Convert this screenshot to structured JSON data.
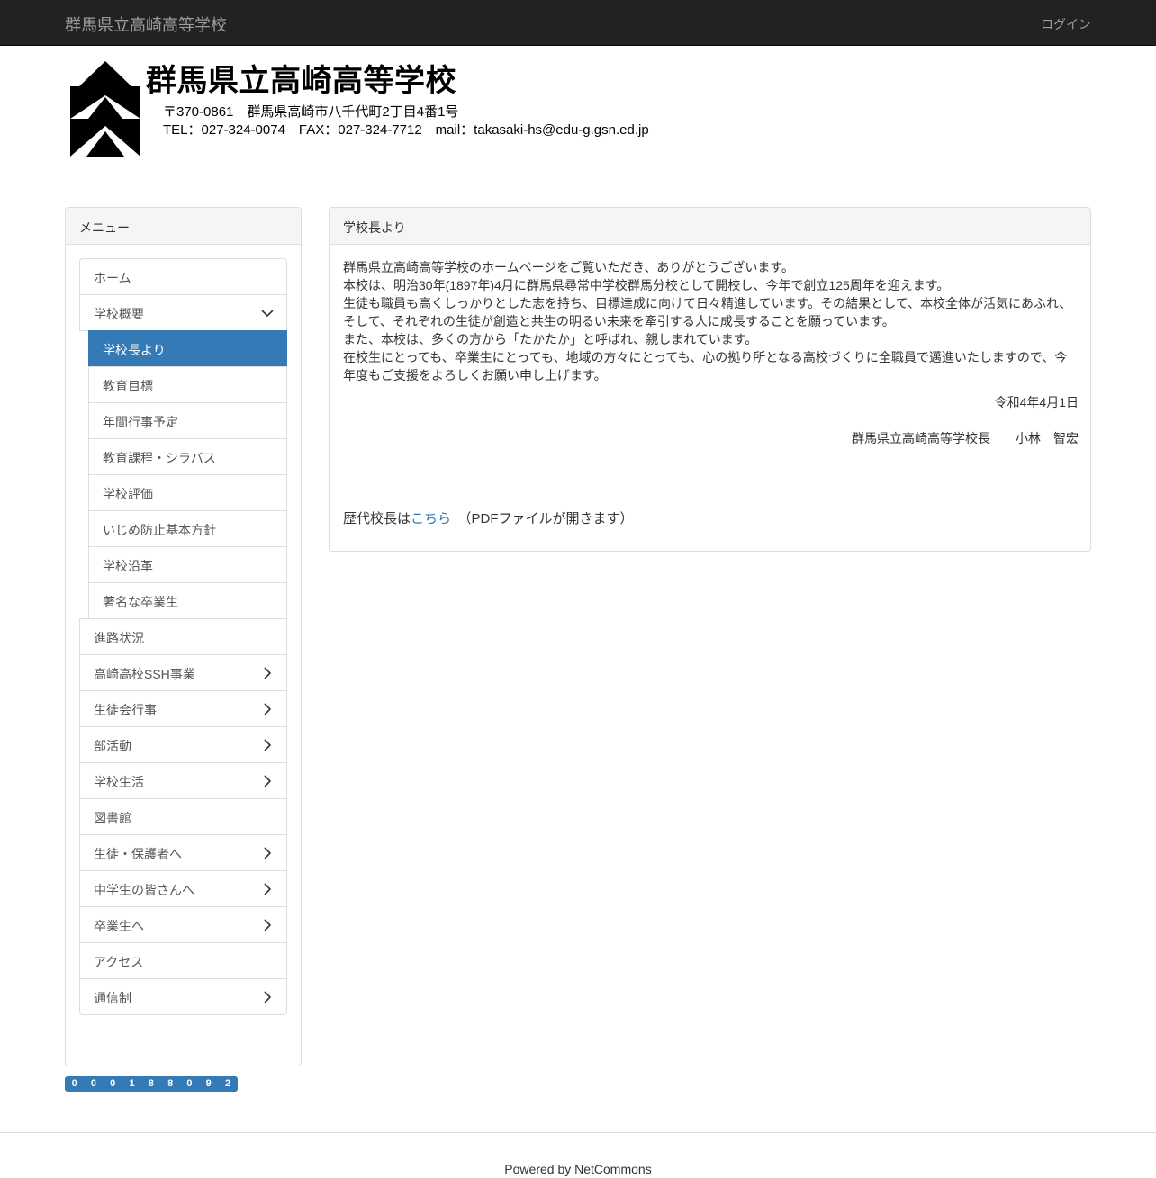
{
  "navbar": {
    "brand": "群馬県立高崎高等学校",
    "login": "ログイン"
  },
  "header": {
    "title": "群馬県立高崎高等学校",
    "address_line": "〒370-0861　群馬県高崎市八千代町2丁目4番1号",
    "contact_line": "TEL：027-324-0074　FAX：027-324-7712　mail：takasaki-hs@edu-g.gsn.ed.jp"
  },
  "menu": {
    "heading": "メニュー",
    "items": [
      {
        "label": "ホーム"
      },
      {
        "label": "学校概要",
        "icon": "chevron-down-icon"
      },
      {
        "label": "学校長より",
        "active": true
      },
      {
        "label": "教育目標"
      },
      {
        "label": "年間行事予定"
      },
      {
        "label": "教育課程・シラバス"
      },
      {
        "label": "学校評価"
      },
      {
        "label": "いじめ防止基本方針"
      },
      {
        "label": "学校沿革"
      },
      {
        "label": "著名な卒業生"
      },
      {
        "label": "進路状況"
      },
      {
        "label": "高崎高校SSH事業",
        "icon": "chevron-right-icon"
      },
      {
        "label": "生徒会行事",
        "icon": "chevron-right-icon"
      },
      {
        "label": "部活動",
        "icon": "chevron-right-icon"
      },
      {
        "label": "学校生活",
        "icon": "chevron-right-icon"
      },
      {
        "label": "図書館"
      },
      {
        "label": "生徒・保護者へ",
        "icon": "chevron-right-icon"
      },
      {
        "label": "中学生の皆さんへ",
        "icon": "chevron-right-icon"
      },
      {
        "label": "卒業生へ",
        "icon": "chevron-right-icon"
      },
      {
        "label": "アクセス"
      },
      {
        "label": "通信制",
        "icon": "chevron-right-icon"
      }
    ]
  },
  "counter": {
    "digits": [
      "0",
      "0",
      "0",
      "1",
      "8",
      "8",
      "0",
      "9",
      "2"
    ]
  },
  "main": {
    "heading": "学校長より",
    "paragraphs": [
      "群馬県立高崎高等学校のホームページをご覧いただき、ありがとうございます。",
      "本校は、明治30年(1897年)4月に群馬県尋常中学校群馬分校として開校し、今年で創立125周年を迎えます。",
      "生徒も職員も高くしっかりとした志を持ち、目標達成に向けて日々精進しています。その結果として、本校全体が活気にあふれ、そして、それぞれの生徒が創造と共生の明るい未来を牽引する人に成長することを願っています。",
      "また、本校は、多くの方から「たかたか」と呼ばれ、親しまれています。",
      "在校生にとっても、卒業生にとっても、地域の方々にとっても、心の拠り所となる高校づくりに全職員で邁進いたしますので、今年度もご支援をよろしくお願い申し上げます。"
    ],
    "date": "令和4年4月1日",
    "signature": "群馬県立高崎高等学校長　　小林　智宏",
    "history_prefix": "歴代校長は",
    "history_link": "こちら",
    "history_suffix": "　（PDFファイルが開きます）"
  },
  "footer": {
    "powered": "Powered by NetCommons"
  },
  "colors": {
    "navbar": "#222222",
    "accent": "#337ab7"
  }
}
